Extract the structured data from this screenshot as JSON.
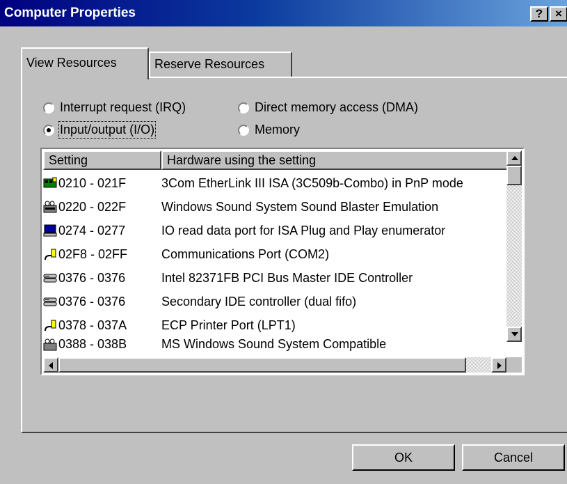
{
  "window": {
    "title": "Computer Properties",
    "help_button": "?",
    "close_button": "×"
  },
  "tabs": [
    {
      "label": "View Resources",
      "active": true
    },
    {
      "label": "Reserve Resources",
      "active": false
    }
  ],
  "radios": [
    {
      "label": "Interrupt request (IRQ)",
      "checked": false
    },
    {
      "label": "Direct memory access (DMA)",
      "checked": false
    },
    {
      "label": "Input/output (I/O)",
      "checked": true
    },
    {
      "label": "Memory",
      "checked": false
    }
  ],
  "list": {
    "columns": [
      "Setting",
      "Hardware using the setting"
    ],
    "rows": [
      {
        "icon": "network-card-icon",
        "setting": "0210 - 021F",
        "hardware": "3Com EtherLink III ISA (3C509b-Combo) in PnP mode"
      },
      {
        "icon": "sound-card-icon",
        "setting": "0220 - 022F",
        "hardware": "Windows Sound System Sound Blaster Emulation"
      },
      {
        "icon": "computer-icon",
        "setting": "0274 - 0277",
        "hardware": "IO read data port for ISA Plug and Play enumerator"
      },
      {
        "icon": "port-icon",
        "setting": "02F8 - 02FF",
        "hardware": "Communications Port (COM2)"
      },
      {
        "icon": "disk-controller-icon",
        "setting": "0376 - 0376",
        "hardware": "Intel 82371FB PCI Bus Master IDE Controller"
      },
      {
        "icon": "disk-controller-icon",
        "setting": "0376 - 0376",
        "hardware": "Secondary IDE controller (dual fifo)"
      },
      {
        "icon": "port-icon",
        "setting": "0378 - 037A",
        "hardware": "ECP Printer Port (LPT1)"
      },
      {
        "icon": "sound-card-icon",
        "setting": "0388 - 038B",
        "hardware": "MS Windows Sound System Compatible"
      }
    ]
  },
  "buttons": {
    "ok": "OK",
    "cancel": "Cancel"
  }
}
